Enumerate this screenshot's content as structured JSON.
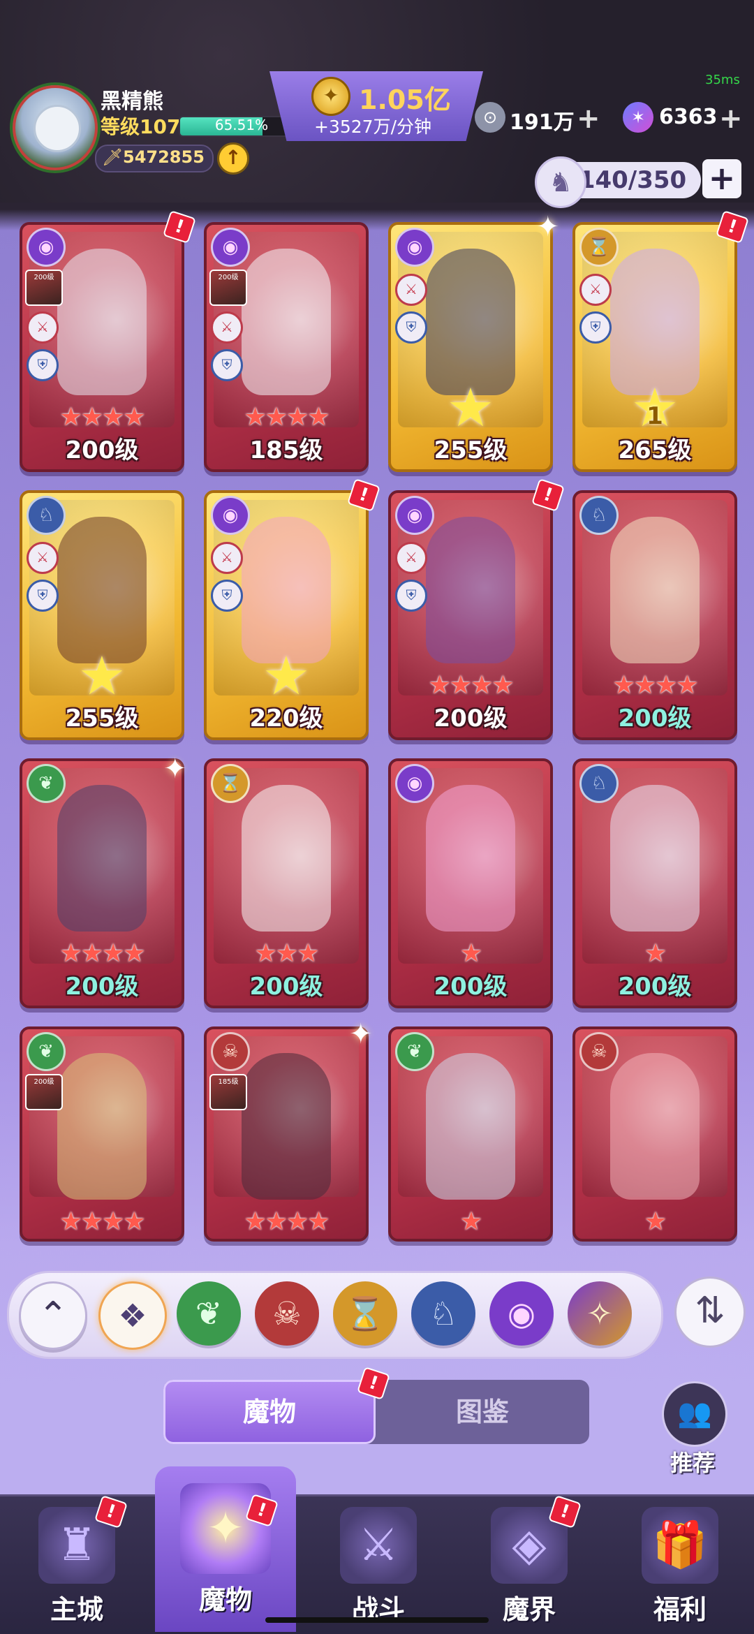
{
  "player": {
    "name": "黑精熊",
    "level": "等级107",
    "exp_percent": "65.51%",
    "exp_fraction": 0.6551,
    "power": "5472855"
  },
  "currency": {
    "gold": "1.05亿",
    "gold_rate": "+3527万/分钟",
    "silver": "191万",
    "gems": "6363"
  },
  "latency": "35ms",
  "capacity": "140/350",
  "cards": [
    {
      "level": "200级",
      "frame": "red",
      "stars": 4,
      "faction": "purple",
      "alert": true,
      "thumb": "200级",
      "teal": false
    },
    {
      "level": "185级",
      "frame": "red",
      "stars": 4,
      "faction": "purple",
      "alert": false,
      "thumb": "200级",
      "teal": false
    },
    {
      "level": "255级",
      "frame": "gold",
      "stars": 0,
      "big_star": "",
      "faction": "purple",
      "alert": false,
      "teal": false
    },
    {
      "level": "265级",
      "frame": "gold",
      "stars": 0,
      "big_star": "1",
      "faction": "gold",
      "alert": true,
      "teal": false
    },
    {
      "level": "255级",
      "frame": "gold",
      "stars": 0,
      "big_star": "",
      "faction": "blue",
      "alert": false,
      "teal": false
    },
    {
      "level": "220级",
      "frame": "gold",
      "stars": 0,
      "big_star": "",
      "faction": "purple",
      "alert": true,
      "teal": false
    },
    {
      "level": "200级",
      "frame": "red",
      "stars": 4,
      "faction": "purple",
      "alert": true,
      "teal": false
    },
    {
      "level": "200级",
      "frame": "red",
      "stars": 4,
      "faction": "blue",
      "alert": false,
      "teal": true
    },
    {
      "level": "200级",
      "frame": "red",
      "stars": 4,
      "faction": "green",
      "alert": false,
      "teal": true
    },
    {
      "level": "200级",
      "frame": "red",
      "stars": 3,
      "faction": "gold",
      "alert": false,
      "teal": true
    },
    {
      "level": "200级",
      "frame": "red",
      "stars": 1,
      "faction": "purple",
      "alert": false,
      "teal": true
    },
    {
      "level": "200级",
      "frame": "red",
      "stars": 1,
      "faction": "blue",
      "alert": false,
      "teal": true
    },
    {
      "level": "",
      "frame": "red",
      "stars": 4,
      "faction": "green",
      "alert": false,
      "thumb": "200级",
      "teal": false
    },
    {
      "level": "",
      "frame": "red",
      "stars": 4,
      "faction": "red",
      "alert": false,
      "thumb": "185级",
      "teal": false
    },
    {
      "level": "",
      "frame": "red",
      "stars": 1,
      "faction": "green",
      "alert": false,
      "teal": false
    },
    {
      "level": "",
      "frame": "red",
      "stars": 1,
      "faction": "red",
      "alert": false,
      "teal": false
    }
  ],
  "filters": [
    "collapse-up",
    "all",
    "green",
    "red",
    "gold",
    "blue",
    "purple",
    "purple-gold"
  ],
  "tabs": {
    "monsters": "魔物",
    "codex": "图鉴"
  },
  "recommend": "推荐",
  "nav": {
    "city": "主城",
    "monsters": "魔物",
    "battle": "战斗",
    "realm": "魔界",
    "welfare": "福利"
  }
}
